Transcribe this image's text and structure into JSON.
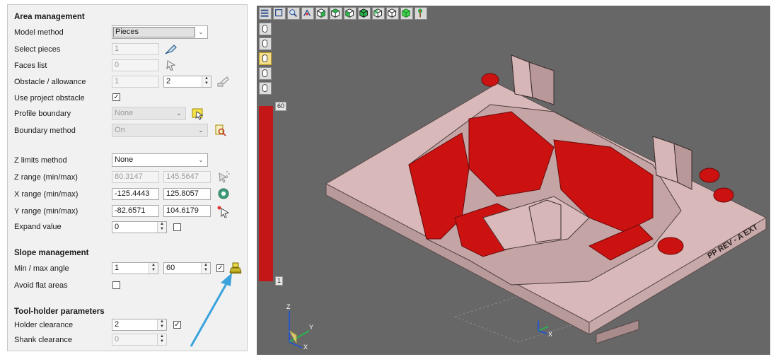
{
  "panel": {
    "area_management": {
      "title": "Area management",
      "model_method": {
        "label": "Model method",
        "value": "Pieces"
      },
      "select_pieces": {
        "label": "Select pieces",
        "value": "1"
      },
      "faces_list": {
        "label": "Faces list",
        "value": "0"
      },
      "obstacle_allowance": {
        "label": "Obstacle / allowance",
        "value1": "1",
        "value2": "2"
      },
      "use_project_obstacle": {
        "label": "Use project obstacle",
        "checked": "✓"
      },
      "profile_boundary": {
        "label": "Profile boundary",
        "value": "None"
      },
      "boundary_method": {
        "label": "Boundary method",
        "value": "On"
      },
      "z_limits_method": {
        "label": "Z limits method",
        "value": "None"
      },
      "z_range": {
        "label": "Z range (min/max)",
        "min": "80.3147",
        "max": "145.5647"
      },
      "x_range": {
        "label": "X range (min/max)",
        "min": "-125.4443",
        "max": "125.8057"
      },
      "y_range": {
        "label": "Y range (min/max)",
        "min": "-82.6571",
        "max": "104.6179"
      },
      "expand_value": {
        "label": "Expand value",
        "value": "0"
      }
    },
    "slope_management": {
      "title": "Slope management",
      "min_max_angle": {
        "label": "Min / max angle",
        "min": "1",
        "max": "60",
        "checked": "✓"
      },
      "avoid_flat_areas": {
        "label": "Avoid flat areas"
      }
    },
    "tool_holder": {
      "title": "Tool-holder parameters",
      "holder_clearance": {
        "label": "Holder clearance",
        "value": "2",
        "checked": "✓"
      },
      "shank_clearance": {
        "label": "Shank clearance",
        "value": "0"
      }
    }
  },
  "viewport": {
    "scale_max": "60",
    "scale_min": "1",
    "part_text": "PP REV - A EXT",
    "axes": {
      "x": "X",
      "y": "Y",
      "z": "Z"
    },
    "toolbar_icons": [
      "menu-icon",
      "fit-view-icon",
      "zoom-icon",
      "rotate-icon",
      "view-iso-icon",
      "view-top-icon",
      "view-front-icon",
      "view-right-icon",
      "view-left-icon",
      "view-back-icon",
      "view-shaded-icon",
      "tree-icon"
    ],
    "side_icons": [
      "tool-cylinder-icon",
      "tool-cylinder-icon",
      "tool-cylinder-active-icon",
      "tool-cylinder-icon",
      "tool-cylinder-icon"
    ]
  },
  "colors": {
    "highlight": "#cc1111",
    "part": "#d9b9b9",
    "background": "#676767",
    "accent_arrow": "#3aa3dc"
  }
}
